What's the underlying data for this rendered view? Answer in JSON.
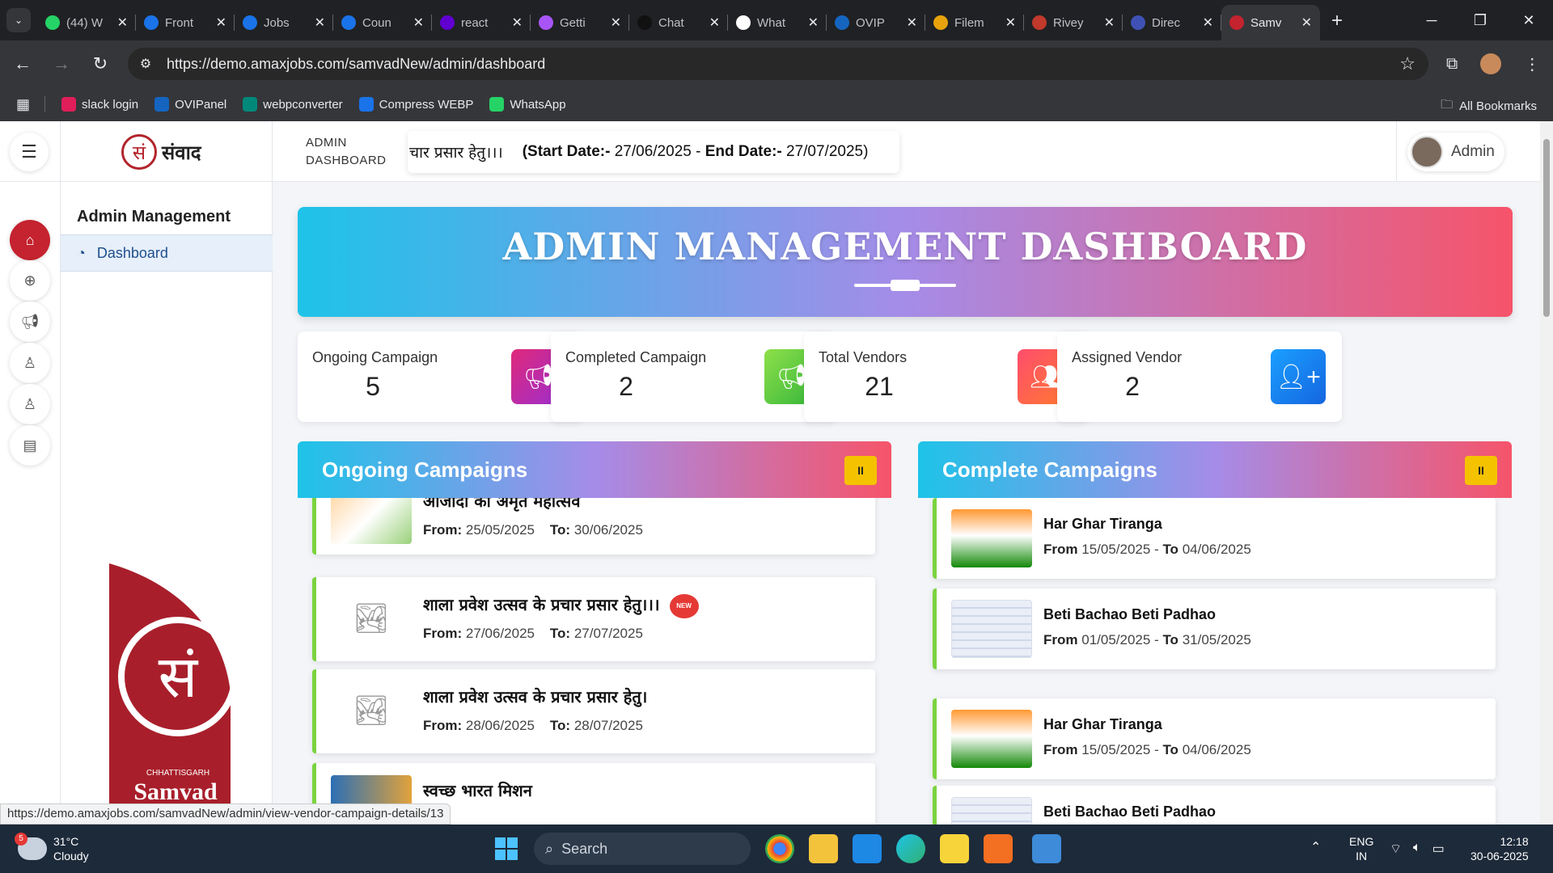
{
  "browser": {
    "tabs": [
      {
        "title": "(44) W",
        "color": "#25d366"
      },
      {
        "title": "Front",
        "color": "#1a73e8"
      },
      {
        "title": "Jobs",
        "color": "#1a73e8"
      },
      {
        "title": "Coun",
        "color": "#1a73e8"
      },
      {
        "title": "react",
        "color": "#6001d2"
      },
      {
        "title": "Getti",
        "color": "#a855f7"
      },
      {
        "title": "Chat",
        "color": "#111111"
      },
      {
        "title": "What",
        "color": "#ffffff"
      },
      {
        "title": "OVIP",
        "color": "#1565c0"
      },
      {
        "title": "Filem",
        "color": "#e8a20c"
      },
      {
        "title": "Rivey",
        "color": "#c0392b"
      },
      {
        "title": "Direc",
        "color": "#3f51b5"
      },
      {
        "title": "Samv",
        "color": "#c4232f",
        "active": true
      }
    ],
    "url": "https://demo.amaxjobs.com/samvadNew/admin/dashboard",
    "bookmarks": [
      {
        "label": "slack login",
        "color": "#e01e5a"
      },
      {
        "label": "OVIPanel",
        "color": "#1565c0"
      },
      {
        "label": "webpconverter",
        "color": "#00897b"
      },
      {
        "label": "Compress WEBP",
        "color": "#1a73e8"
      },
      {
        "label": "WhatsApp",
        "color": "#25d366"
      }
    ],
    "all_bookmarks": "All Bookmarks",
    "status_url": "https://demo.amaxjobs.com/samvadNew/admin/view-vendor-campaign-details/13"
  },
  "header": {
    "logo_text": "संवाद",
    "breadcrumb_line1": "ADMIN",
    "breadcrumb_line2": "DASHBOARD",
    "ticker_title": "चार प्रसार हेतु।।।",
    "ticker_start_label": "Start Date:-",
    "ticker_start": "27/06/2025",
    "ticker_end_label": "End Date:-",
    "ticker_end": "27/07/2025",
    "admin_label": "Admin"
  },
  "sidebar": {
    "title": "Admin Management",
    "active_item": "Dashboard",
    "brand_small": "CHHATTISGARH",
    "brand_big": "Samvad"
  },
  "banner": {
    "title": "ADMIN MANAGEMENT DASHBOARD"
  },
  "stats": [
    {
      "label": "Ongoing Campaign",
      "value": "5",
      "color": "linear-gradient(135deg,#e0287a,#9b2fd0)",
      "icon": "megaphone-icon"
    },
    {
      "label": "Completed Campaign",
      "value": "2",
      "color": "linear-gradient(135deg,#8ee04a,#34b53a)",
      "icon": "megaphone-icon"
    },
    {
      "label": "Total Vendors",
      "value": "21",
      "color": "linear-gradient(135deg,#ff4d6d,#ff7a2f)",
      "icon": "users-icon"
    },
    {
      "label": "Assigned Vendor",
      "value": "2",
      "color": "linear-gradient(135deg,#1aa0ff,#1565e0)",
      "icon": "user-plus-icon"
    }
  ],
  "ongoing": {
    "title": "Ongoing Campaigns",
    "pause_label": "II",
    "items": [
      {
        "title": "आजादी का अमृत महोत्सव",
        "from": "25/05/2025",
        "to": "30/06/2025",
        "thumb": "azadi",
        "badge": false
      },
      {
        "title": "शाला प्रवेश उत्सव के प्रचार प्रसार हेतु।।।",
        "from": "27/06/2025",
        "to": "27/07/2025",
        "thumb": "placeholder",
        "badge": true
      },
      {
        "title": "शाला प्रवेश उत्सव के प्रचार प्रसार हेतु।",
        "from": "28/06/2025",
        "to": "28/07/2025",
        "thumb": "placeholder",
        "badge": false
      },
      {
        "title": "स्वच्छ भारत मिशन",
        "from": "",
        "to": "",
        "thumb": "sb",
        "badge": false
      }
    ],
    "from_label": "From:",
    "to_label": "To:",
    "badge_text": "NEW"
  },
  "complete": {
    "title": "Complete Campaigns",
    "pause_label": "II",
    "items": [
      {
        "title": "Har Ghar Tiranga",
        "from": "15/05/2025",
        "to": "04/06/2025",
        "thumb": "tiranga"
      },
      {
        "title": "Beti Bachao Beti Padhao",
        "from": "01/05/2025",
        "to": "31/05/2025",
        "thumb": "bb"
      },
      {
        "title": "Har Ghar Tiranga",
        "from": "15/05/2025",
        "to": "04/06/2025",
        "thumb": "tiranga"
      },
      {
        "title": "Beti Bachao Beti Padhao",
        "from": "",
        "to": "",
        "thumb": "bb"
      }
    ],
    "from_label": "From",
    "to_label": "To"
  },
  "taskbar": {
    "temp": "31°C",
    "condition": "Cloudy",
    "weather_badge": "5",
    "search": "Search",
    "lang1": "ENG",
    "lang2": "IN",
    "time": "12:18",
    "date": "30-06-2025"
  }
}
